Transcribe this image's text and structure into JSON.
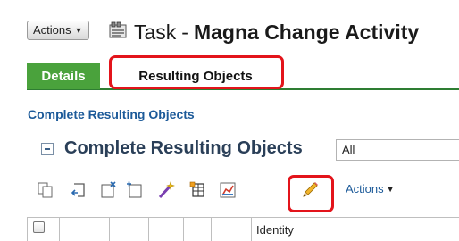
{
  "header": {
    "actions_label": "Actions",
    "object_type": "Task",
    "separator": "-",
    "object_name": "Magna Change Activity"
  },
  "tabs": [
    {
      "label": "Details",
      "active": true
    },
    {
      "label": "Resulting Objects",
      "active": false,
      "highlighted": true
    }
  ],
  "section": {
    "link_label": "Complete Resulting Objects"
  },
  "table": {
    "title": "Complete Resulting Objects",
    "filter_value": "All",
    "toolbar": {
      "icons": [
        "copy-icon",
        "paste-icon",
        "add-object-icon",
        "remove-object-icon",
        "wand-icon",
        "table-settings-icon",
        "chart-icon",
        "pencil-icon"
      ],
      "actions_label": "Actions",
      "highlighted_icon": "pencil-icon"
    },
    "columns": [
      "",
      "",
      "",
      "",
      "",
      "Identity"
    ]
  },
  "colors": {
    "tab_active": "#4aa23c",
    "link": "#1c5a99",
    "highlight": "#e3141b"
  }
}
